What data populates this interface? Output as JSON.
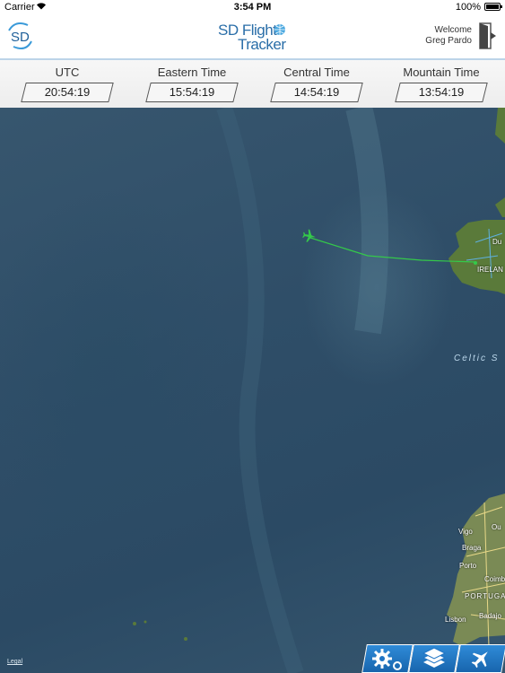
{
  "status_bar": {
    "carrier": "Carrier",
    "time": "3:54 PM",
    "battery": "100%",
    "battery_level": 1.0,
    "wifi_icon": "wifi-icon"
  },
  "header": {
    "logo_text": "SD",
    "brand_line1": "SD Flight",
    "brand_line2": "Tracker",
    "welcome": "Welcome",
    "user_name": "Greg Pardo",
    "logout_icon": "logout-icon"
  },
  "clocks": [
    {
      "label": "UTC",
      "time": "20:54:19"
    },
    {
      "label": "Eastern Time",
      "time": "15:54:19"
    },
    {
      "label": "Central Time",
      "time": "14:54:19"
    },
    {
      "label": "Mountain Time",
      "time": "13:54:19"
    }
  ],
  "map": {
    "labels": {
      "ireland": "IRELAN",
      "dublin": "Du",
      "celtic_sea": "Celtic S",
      "vigo": "Vigo",
      "ourense": "Ou",
      "braga": "Braga",
      "porto": "Porto",
      "coimbra": "Coimb",
      "portugal": "PORTUGA",
      "lisbon": "Lisbon",
      "badajoz": "Badajo"
    },
    "legal": "Legal",
    "flight_path_color": "#34c94a"
  },
  "toolbar": {
    "settings_icon": "settings-icon",
    "layers_icon": "layers-icon",
    "flights_icon": "airplane-icon",
    "accent": "#1f74c4"
  }
}
